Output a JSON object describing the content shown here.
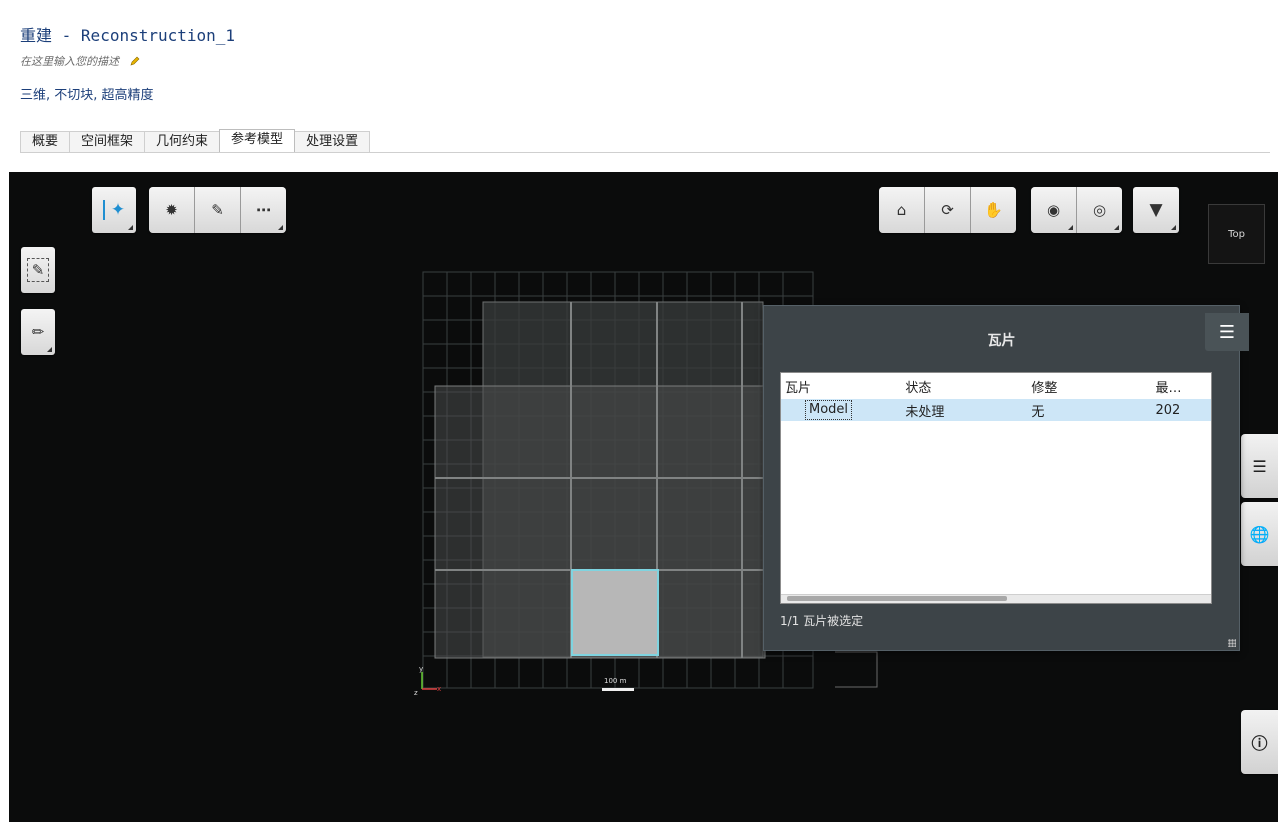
{
  "header": {
    "title_prefix": "重建",
    "title_sep": " - ",
    "title_name": "Reconstruction_1",
    "description_placeholder": "在这里输入您的描述",
    "subtitle": "三维, 不切块, 超高精度"
  },
  "tabs": [
    {
      "label": "概要",
      "active": false
    },
    {
      "label": "空间框架",
      "active": false
    },
    {
      "label": "几何约束",
      "active": false
    },
    {
      "label": "参考模型",
      "active": true
    },
    {
      "label": "处理设置",
      "active": false
    }
  ],
  "viewport": {
    "view_cube_label": "Top",
    "scale_label": "100 m",
    "axis_y": "y",
    "axis_z": "z",
    "axis_x": "x"
  },
  "tiles_panel": {
    "title": "瓦片",
    "columns": [
      "瓦片",
      "状态",
      "修整",
      "最…"
    ],
    "rows": [
      {
        "tile": "Model",
        "status": "未处理",
        "trim": "无",
        "last": "202"
      }
    ],
    "status_text": "1/1 瓦片被选定"
  },
  "colors": {
    "title_blue": "#1c3f7a",
    "viewport_bg": "#0b0c0c",
    "selected_row": "#cde6f7",
    "selection_outline": "#7fd4e0",
    "panel_bg": "#3d4448"
  },
  "icons": [
    "pencil-icon",
    "select-arrow-icon",
    "brush-select-icon",
    "edit-pen-icon",
    "more-icon",
    "home-icon",
    "orbit-icon",
    "pan-hand-icon",
    "focus-icon",
    "visibility-eye-icon",
    "filter-icon",
    "annotate-icon",
    "measure-ruler-icon",
    "list-menu-icon",
    "layers-icon",
    "globe-icon",
    "info-icon"
  ]
}
